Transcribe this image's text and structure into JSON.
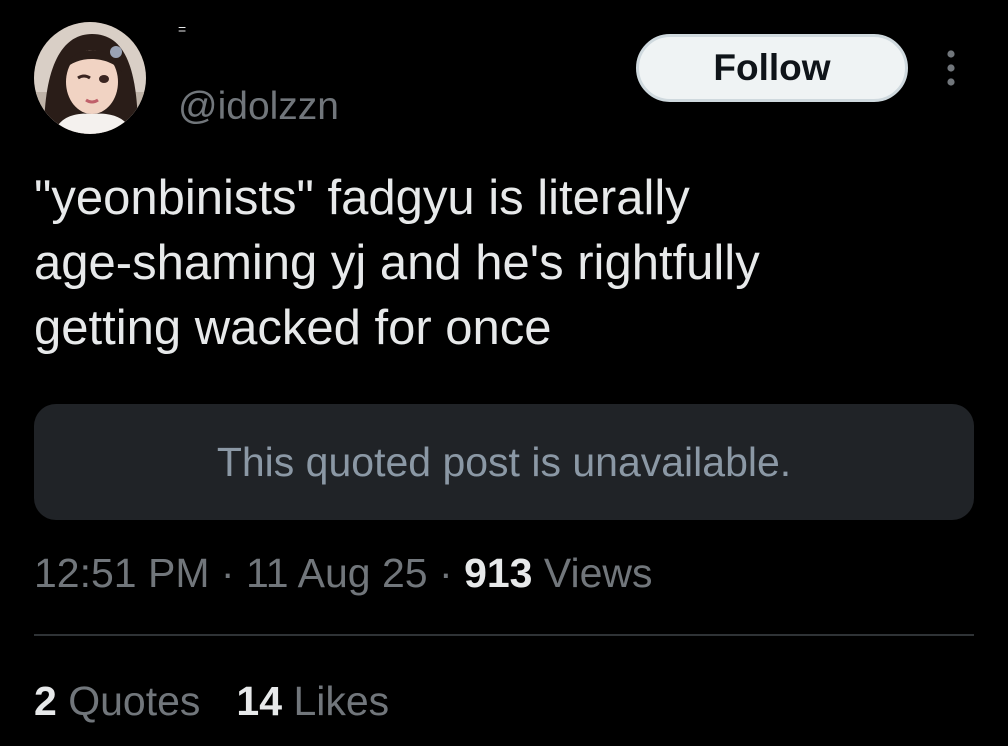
{
  "author": {
    "display_name": "=",
    "handle": "@idolzzn",
    "avatar_icon": "profile-photo-icon"
  },
  "header": {
    "follow_label": "Follow",
    "more_icon": "more-options-icon"
  },
  "tweet": {
    "lines": [
      "\"yeonbinists\" fadgyu is literally",
      "age-shaming yj and he's rightfully",
      "getting wacked for once"
    ]
  },
  "quote": {
    "unavailable_text": "This quoted post is unavailable."
  },
  "meta": {
    "time": "12:51 PM",
    "separator": "·",
    "date": "11 Aug 25",
    "views_count": "913",
    "views_label": "Views"
  },
  "stats": {
    "quotes_count": "2",
    "quotes_label": "Quotes",
    "likes_count": "14",
    "likes_label": "Likes"
  },
  "colors": {
    "background": "#000000",
    "text_primary": "#e7e9ea",
    "text_secondary": "#71767b",
    "follow_bg": "#eff3f4",
    "quote_bg": "#202327",
    "divider": "#2f3336"
  }
}
